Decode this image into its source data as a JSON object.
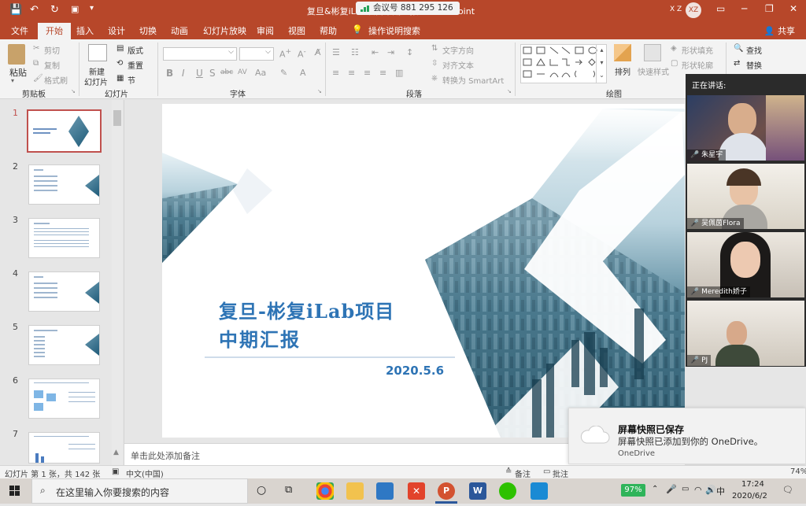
{
  "title_bar": {
    "document_title": "复旦&彬复iLab项目中期汇报 - PowerPoint",
    "meeting_id_text": "会议号 881 295 126",
    "user_initials": "X Z",
    "avatar_text": "XZ"
  },
  "ribbon_tabs": [
    "文件",
    "开始",
    "插入",
    "设计",
    "切换",
    "动画",
    "幻灯片放映",
    "审阅",
    "视图",
    "帮助"
  ],
  "tell_me": "操作说明搜索",
  "share": "共享",
  "ribbon": {
    "clipboard": {
      "paste": "粘贴",
      "cut": "剪切",
      "copy": "复制",
      "format_painter": "格式刷",
      "label": "剪贴板"
    },
    "slides": {
      "new_slide": "新建",
      "new_slide_2": "幻灯片",
      "layout": "版式",
      "reset": "重置",
      "section": "节",
      "label": "幻灯片"
    },
    "font": {
      "label": "字体"
    },
    "paragraph": {
      "text_direction": "文字方向",
      "align_text": "对齐文本",
      "smartart": "转换为 SmartArt",
      "label": "段落"
    },
    "drawing": {
      "arrange": "排列",
      "quick_styles": "快速样式",
      "shape_fill": "形状填充",
      "shape_outline": "形状轮廓",
      "label": "绘图"
    },
    "editing": {
      "find": "查找",
      "replace": "替换"
    }
  },
  "thumbnails": [
    "1",
    "2",
    "3",
    "4",
    "5",
    "6",
    "7"
  ],
  "slide": {
    "title_line1": "复旦-彬复iLab项目",
    "title_line2": "中期汇报",
    "date": "2020.5.6"
  },
  "notes_placeholder": "单击此处添加备注",
  "video_panel": {
    "header": "正在讲话:",
    "participants": [
      "朱星宇",
      "吴佩茵Flora",
      "Meredith娇子",
      "PJ"
    ]
  },
  "toast": {
    "title": "屏幕快照已保存",
    "message": "屏幕快照已添加到你的 OneDrive。",
    "source": "OneDrive"
  },
  "status_bar": {
    "slide_info": "幻灯片 第 1 张，共 142 张",
    "language": "中文(中国)",
    "notes": "备注",
    "comments": "批注",
    "zoom": "74%"
  },
  "taskbar": {
    "search_placeholder": "在这里输入你要搜索的内容",
    "battery": "97%",
    "ime": "中",
    "time": "17:24",
    "date": "2020/6/2"
  },
  "colors": {
    "accent": "#b7472a",
    "slide_title": "#2e74b5",
    "taskbar": "#d9d4cf"
  }
}
